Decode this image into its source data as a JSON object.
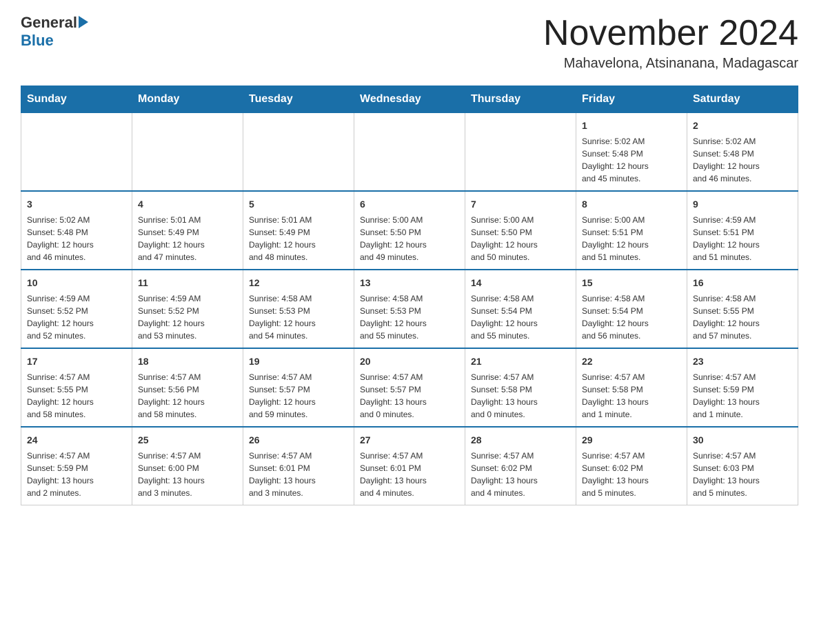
{
  "logo": {
    "text_general": "General",
    "text_blue": "Blue"
  },
  "header": {
    "title": "November 2024",
    "location": "Mahavelona, Atsinanana, Madagascar"
  },
  "weekdays": [
    "Sunday",
    "Monday",
    "Tuesday",
    "Wednesday",
    "Thursday",
    "Friday",
    "Saturday"
  ],
  "weeks": [
    [
      {
        "day": "",
        "info": ""
      },
      {
        "day": "",
        "info": ""
      },
      {
        "day": "",
        "info": ""
      },
      {
        "day": "",
        "info": ""
      },
      {
        "day": "",
        "info": ""
      },
      {
        "day": "1",
        "info": "Sunrise: 5:02 AM\nSunset: 5:48 PM\nDaylight: 12 hours\nand 45 minutes."
      },
      {
        "day": "2",
        "info": "Sunrise: 5:02 AM\nSunset: 5:48 PM\nDaylight: 12 hours\nand 46 minutes."
      }
    ],
    [
      {
        "day": "3",
        "info": "Sunrise: 5:02 AM\nSunset: 5:48 PM\nDaylight: 12 hours\nand 46 minutes."
      },
      {
        "day": "4",
        "info": "Sunrise: 5:01 AM\nSunset: 5:49 PM\nDaylight: 12 hours\nand 47 minutes."
      },
      {
        "day": "5",
        "info": "Sunrise: 5:01 AM\nSunset: 5:49 PM\nDaylight: 12 hours\nand 48 minutes."
      },
      {
        "day": "6",
        "info": "Sunrise: 5:00 AM\nSunset: 5:50 PM\nDaylight: 12 hours\nand 49 minutes."
      },
      {
        "day": "7",
        "info": "Sunrise: 5:00 AM\nSunset: 5:50 PM\nDaylight: 12 hours\nand 50 minutes."
      },
      {
        "day": "8",
        "info": "Sunrise: 5:00 AM\nSunset: 5:51 PM\nDaylight: 12 hours\nand 51 minutes."
      },
      {
        "day": "9",
        "info": "Sunrise: 4:59 AM\nSunset: 5:51 PM\nDaylight: 12 hours\nand 51 minutes."
      }
    ],
    [
      {
        "day": "10",
        "info": "Sunrise: 4:59 AM\nSunset: 5:52 PM\nDaylight: 12 hours\nand 52 minutes."
      },
      {
        "day": "11",
        "info": "Sunrise: 4:59 AM\nSunset: 5:52 PM\nDaylight: 12 hours\nand 53 minutes."
      },
      {
        "day": "12",
        "info": "Sunrise: 4:58 AM\nSunset: 5:53 PM\nDaylight: 12 hours\nand 54 minutes."
      },
      {
        "day": "13",
        "info": "Sunrise: 4:58 AM\nSunset: 5:53 PM\nDaylight: 12 hours\nand 55 minutes."
      },
      {
        "day": "14",
        "info": "Sunrise: 4:58 AM\nSunset: 5:54 PM\nDaylight: 12 hours\nand 55 minutes."
      },
      {
        "day": "15",
        "info": "Sunrise: 4:58 AM\nSunset: 5:54 PM\nDaylight: 12 hours\nand 56 minutes."
      },
      {
        "day": "16",
        "info": "Sunrise: 4:58 AM\nSunset: 5:55 PM\nDaylight: 12 hours\nand 57 minutes."
      }
    ],
    [
      {
        "day": "17",
        "info": "Sunrise: 4:57 AM\nSunset: 5:55 PM\nDaylight: 12 hours\nand 58 minutes."
      },
      {
        "day": "18",
        "info": "Sunrise: 4:57 AM\nSunset: 5:56 PM\nDaylight: 12 hours\nand 58 minutes."
      },
      {
        "day": "19",
        "info": "Sunrise: 4:57 AM\nSunset: 5:57 PM\nDaylight: 12 hours\nand 59 minutes."
      },
      {
        "day": "20",
        "info": "Sunrise: 4:57 AM\nSunset: 5:57 PM\nDaylight: 13 hours\nand 0 minutes."
      },
      {
        "day": "21",
        "info": "Sunrise: 4:57 AM\nSunset: 5:58 PM\nDaylight: 13 hours\nand 0 minutes."
      },
      {
        "day": "22",
        "info": "Sunrise: 4:57 AM\nSunset: 5:58 PM\nDaylight: 13 hours\nand 1 minute."
      },
      {
        "day": "23",
        "info": "Sunrise: 4:57 AM\nSunset: 5:59 PM\nDaylight: 13 hours\nand 1 minute."
      }
    ],
    [
      {
        "day": "24",
        "info": "Sunrise: 4:57 AM\nSunset: 5:59 PM\nDaylight: 13 hours\nand 2 minutes."
      },
      {
        "day": "25",
        "info": "Sunrise: 4:57 AM\nSunset: 6:00 PM\nDaylight: 13 hours\nand 3 minutes."
      },
      {
        "day": "26",
        "info": "Sunrise: 4:57 AM\nSunset: 6:01 PM\nDaylight: 13 hours\nand 3 minutes."
      },
      {
        "day": "27",
        "info": "Sunrise: 4:57 AM\nSunset: 6:01 PM\nDaylight: 13 hours\nand 4 minutes."
      },
      {
        "day": "28",
        "info": "Sunrise: 4:57 AM\nSunset: 6:02 PM\nDaylight: 13 hours\nand 4 minutes."
      },
      {
        "day": "29",
        "info": "Sunrise: 4:57 AM\nSunset: 6:02 PM\nDaylight: 13 hours\nand 5 minutes."
      },
      {
        "day": "30",
        "info": "Sunrise: 4:57 AM\nSunset: 6:03 PM\nDaylight: 13 hours\nand 5 minutes."
      }
    ]
  ]
}
